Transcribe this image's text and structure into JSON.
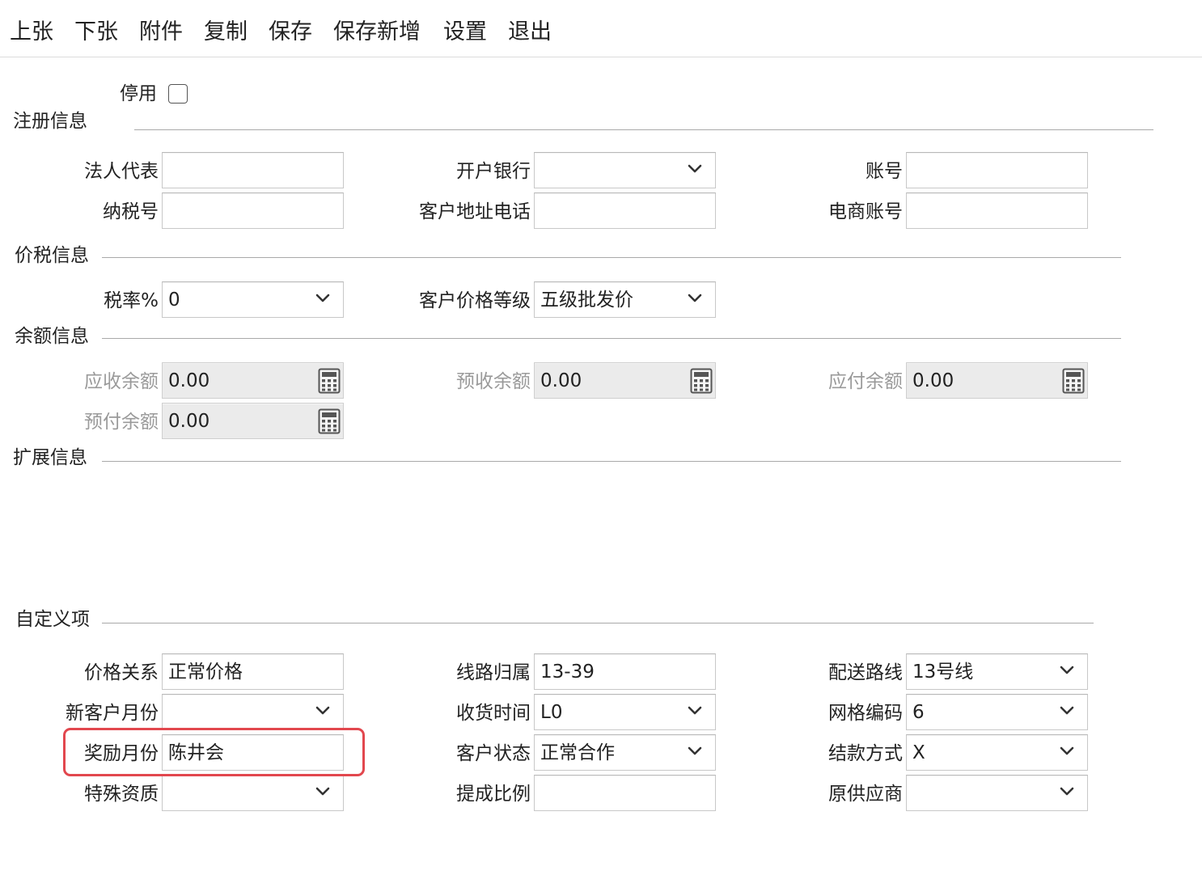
{
  "toolbar": [
    "上张",
    "下张",
    "附件",
    "复制",
    "保存",
    "保存新增",
    "设置",
    "退出"
  ],
  "disabled_label": "停用",
  "sections": {
    "register": "注册信息",
    "tax": "价税信息",
    "balance": "余额信息",
    "extend": "扩展信息",
    "custom": "自定义项"
  },
  "register_fields": {
    "legal_rep": {
      "label": "法人代表",
      "value": ""
    },
    "bank": {
      "label": "开户银行",
      "value": ""
    },
    "account": {
      "label": "账号",
      "value": ""
    },
    "tax_no": {
      "label": "纳税号",
      "value": ""
    },
    "addr_phone": {
      "label": "客户地址电话",
      "value": ""
    },
    "ecom_account": {
      "label": "电商账号",
      "value": ""
    }
  },
  "tax_fields": {
    "tax_rate": {
      "label": "税率%",
      "value": "0"
    },
    "price_level": {
      "label": "客户价格等级",
      "value": "五级批发价"
    }
  },
  "balance_fields": {
    "receivable": {
      "label": "应收余额",
      "value": "0.00"
    },
    "pre_received": {
      "label": "预收余额",
      "value": "0.00"
    },
    "payable": {
      "label": "应付余额",
      "value": "0.00"
    },
    "prepaid": {
      "label": "预付余额",
      "value": "0.00"
    }
  },
  "custom_fields": {
    "price_relation": {
      "label": "价格关系",
      "value": "正常价格"
    },
    "route_belong": {
      "label": "线路归属",
      "value": "13-39"
    },
    "delivery_route": {
      "label": "配送路线",
      "value": "13号线"
    },
    "new_customer_month": {
      "label": "新客户月份",
      "value": ""
    },
    "receive_time": {
      "label": "收货时间",
      "value": "L0"
    },
    "grid_code": {
      "label": "网格编码",
      "value": "6"
    },
    "reward_month": {
      "label": "奖励月份",
      "value": "陈井会"
    },
    "customer_status": {
      "label": "客户状态",
      "value": "正常合作"
    },
    "settlement": {
      "label": "结款方式",
      "value": "X"
    },
    "special_qual": {
      "label": "特殊资质",
      "value": ""
    },
    "commission": {
      "label": "提成比例",
      "value": ""
    },
    "orig_supplier": {
      "label": "原供应商",
      "value": ""
    }
  },
  "colors": {
    "highlight": "#e2474e",
    "rule": "#a9a9a9",
    "readonly_bg": "#ebebeb"
  }
}
